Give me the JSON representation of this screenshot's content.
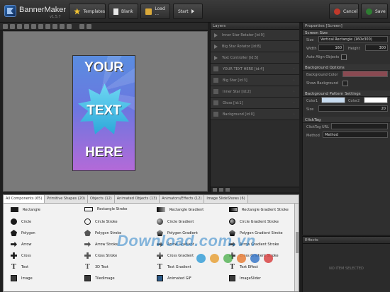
{
  "app": {
    "name": "BannerMaker",
    "version": "v1.5.7"
  },
  "toolbar": {
    "templates": "Templates",
    "blank": "Blank",
    "load": "Load ...",
    "start": "Start",
    "cancel": "Cancel",
    "save": "Save"
  },
  "banner": {
    "line1": "YOUR",
    "line2": "TEXT",
    "line3": "HERE"
  },
  "layers": {
    "title": "Layers",
    "items": [
      "Inner Star Rotator [id:9]",
      "Big Star Rotator [id:8]",
      "Text Controller [id:5]",
      "YOUR TEXT HERE [id:4]",
      "Big Star [id:3]",
      "Inner Star [id:2]",
      "Gloss [id:1]",
      "Background [id:0]"
    ]
  },
  "properties": {
    "title": "Properties [Screen]",
    "screen_size": {
      "title": "Screen Size",
      "size_label": "Size",
      "size_value": "Vertical Rectangle (160x300)",
      "width_label": "Width",
      "width_value": "160",
      "height_label": "Height",
      "height_value": "300",
      "auto_align_label": "Auto Align Objects"
    },
    "background_options": {
      "title": "Background Options",
      "color_label": "Background Color",
      "color_value": "#8a4a52",
      "show_label": "Show Background"
    },
    "pattern": {
      "title": "Background Pattern Settings",
      "color1_label": "Color1",
      "color1_value": "#c8dcf0",
      "color2_label": "Color2",
      "color2_value": "#ffffff",
      "size_label": "Size",
      "size_value": "20"
    },
    "clicktag": {
      "title": "ClickTag",
      "url_label": "ClickTag URL",
      "method_label": "Method",
      "method_value": "Method"
    }
  },
  "effects": {
    "title": "Effects",
    "empty": "NO ITEM SELECTED"
  },
  "components": {
    "tabs": [
      "All Components (65)",
      "Primitive Shapes (20)",
      "Objects (12)",
      "Animated Objects (13)",
      "Animators/Effects (12)",
      "Image SlideShows (6)"
    ],
    "col1": [
      "Rectangle",
      "Circle",
      "Polygon",
      "Arrow",
      "Cross",
      "Text",
      "Image"
    ],
    "col2": [
      "Rectangle Stroke",
      "Circle Stroke",
      "Polygon Stroke",
      "Arrow Stroke",
      "Cross Stroke",
      "3D Text",
      "TiledImage"
    ],
    "col3": [
      "Rectangle Gradient",
      "Circle Gradient",
      "Polygon Gradient",
      "Arrow Gradient",
      "Cross Gradient",
      "Text Gradient",
      "Animated GIF"
    ],
    "col4": [
      "Rectangle Gradient Stroke",
      "Circle Gradient Stroke",
      "Polygon Gradient Stroke",
      "Arrow Gradient Stroke",
      "Cross Gradient Stroke",
      "Text Effect",
      "ImageSlider"
    ]
  },
  "watermark": {
    "text": "Download.com.vn"
  },
  "colors": {
    "accent": "#2aa6d8",
    "banner_top": "#5a8de0",
    "banner_bottom": "#b36ad8"
  }
}
